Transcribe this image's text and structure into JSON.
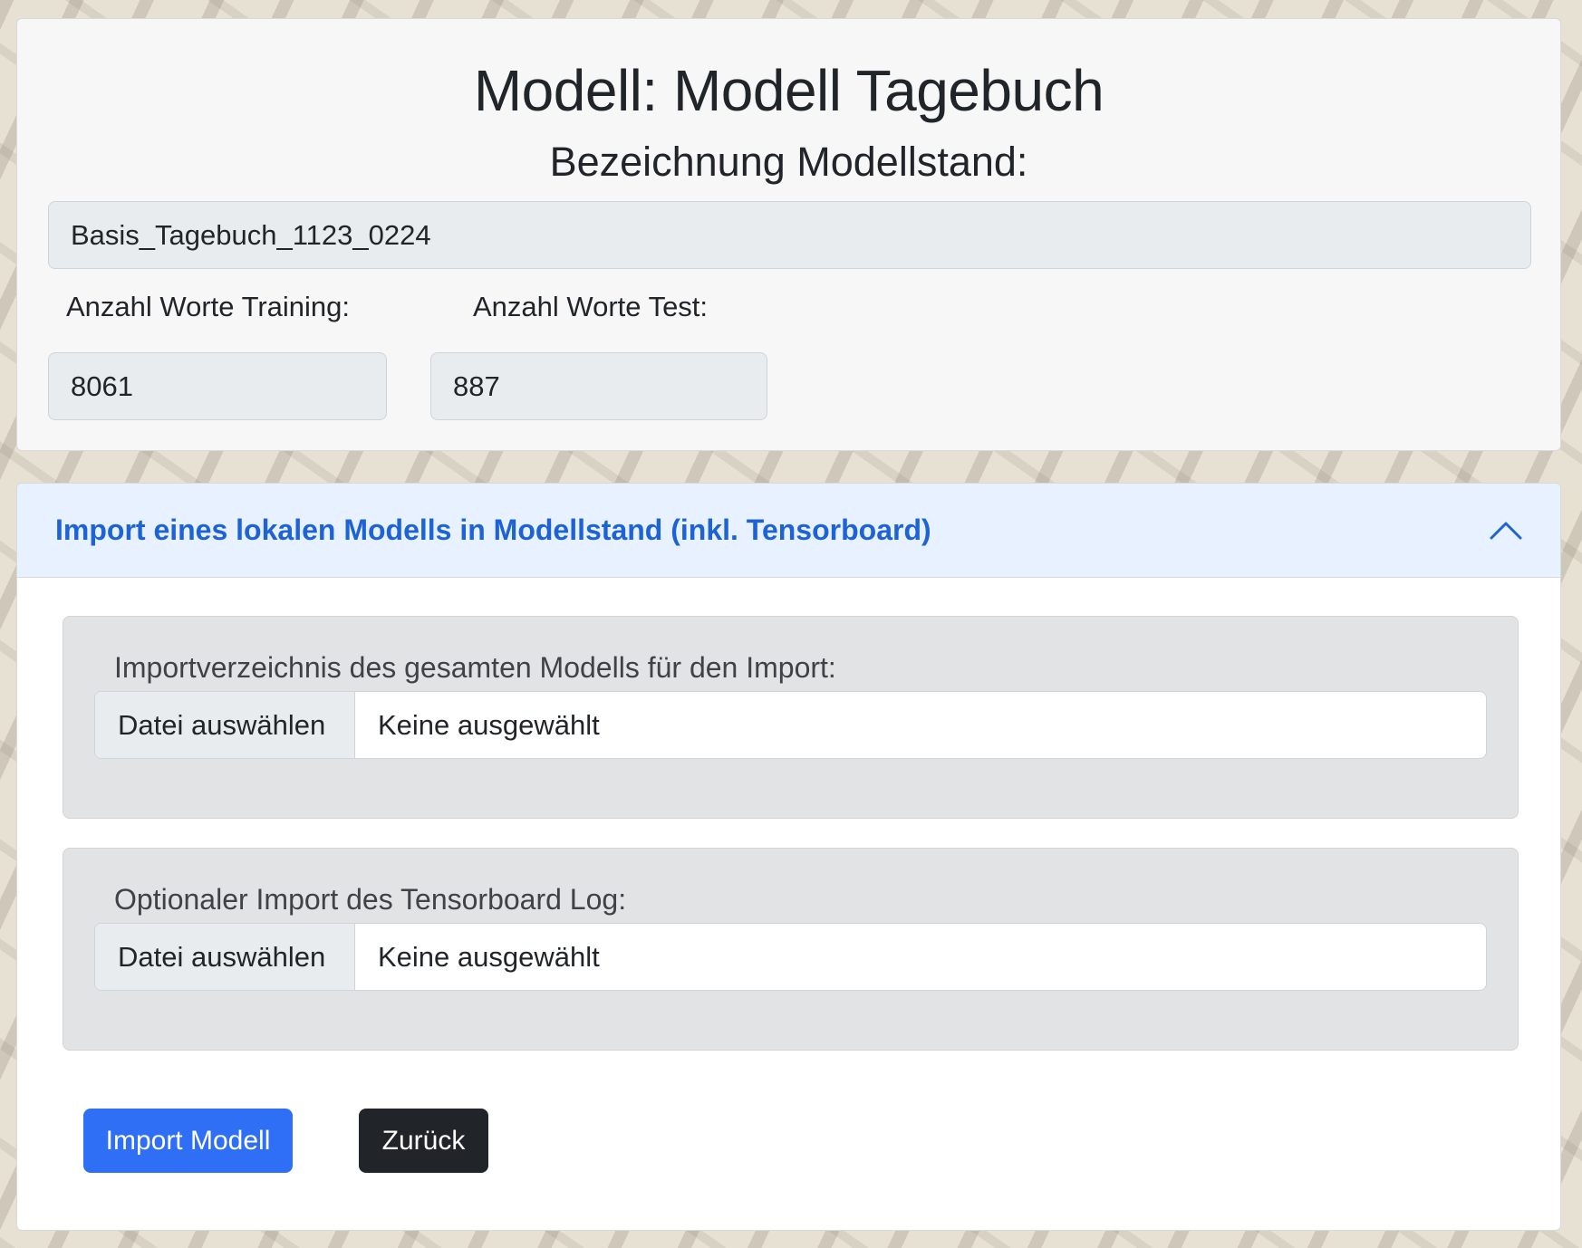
{
  "header": {
    "title": "Modell: Modell Tagebuch",
    "subtitle": "Bezeichnung Modellstand:",
    "model_state_name": "Basis_Tagebuch_1123_0224",
    "training_words_label": "Anzahl Worte Training:",
    "training_words_value": "8061",
    "test_words_label": "Anzahl Worte Test:",
    "test_words_value": "887"
  },
  "import_panel": {
    "title": "Import eines lokalen Modells in Modellstand (inkl. Tensorboard)",
    "expanded": true,
    "model_upload": {
      "label": "Importverzeichnis des gesamten Modells für den Import:",
      "button_label": "Datei auswählen",
      "status": "Keine ausgewählt"
    },
    "tensorboard_upload": {
      "label": "Optionaler Import des Tensorboard Log:",
      "button_label": "Datei auswählen",
      "status": "Keine ausgewählt"
    },
    "import_button_label": "Import Modell",
    "back_button_label": "Zurück"
  },
  "colors": {
    "accent": "#2f6ff5",
    "accordion_title": "#1e63d6",
    "accordion_bg": "#e7f1ff",
    "dark_button": "#212529"
  },
  "icons": {
    "accordion_toggle": "chevron-up-icon"
  }
}
